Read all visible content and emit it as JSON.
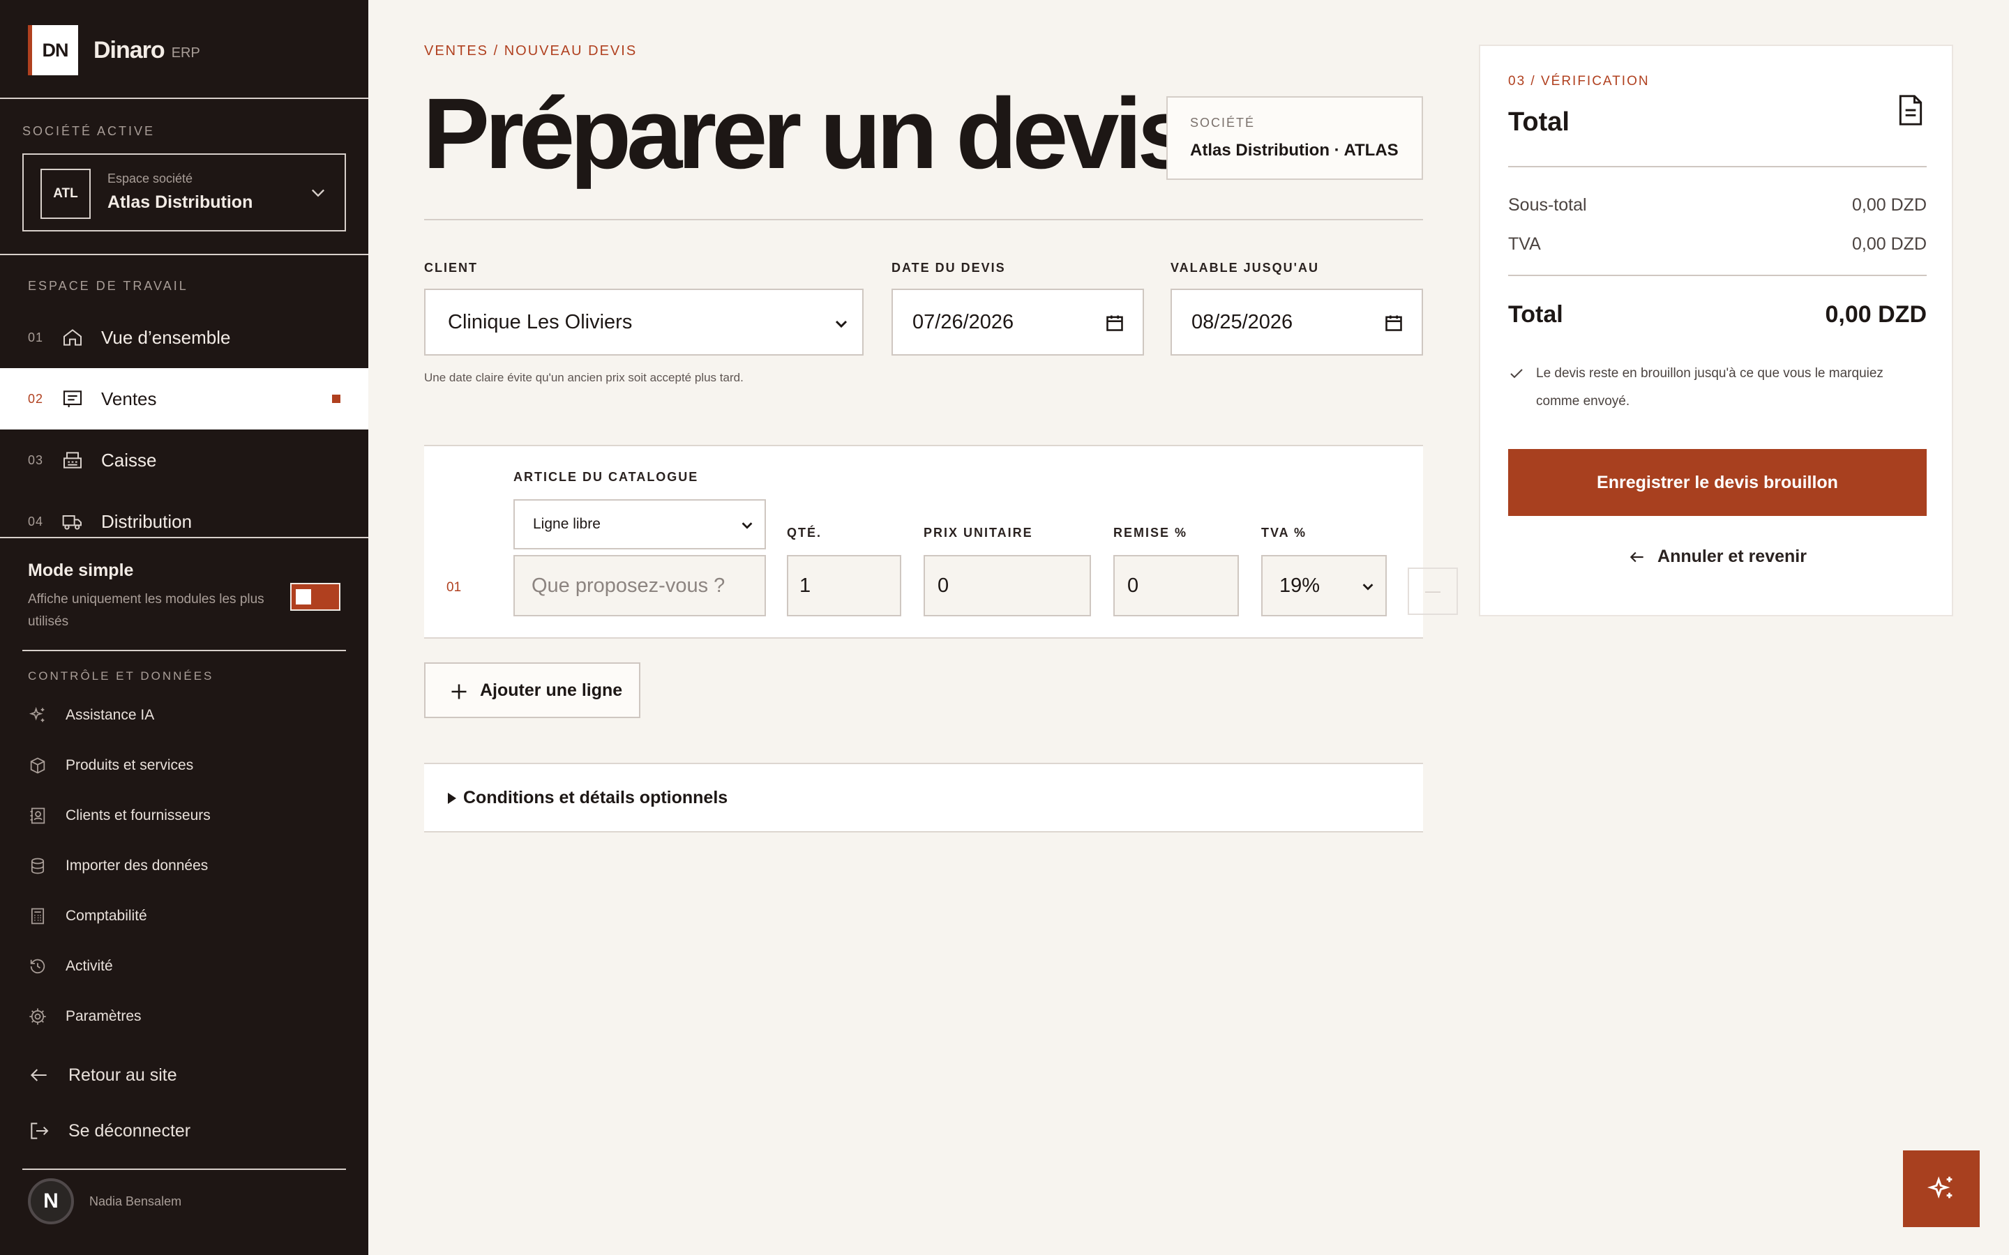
{
  "brand": {
    "logo": "DN",
    "name": "Dinaro",
    "sub": "ERP"
  },
  "sidebar": {
    "active_company_title": "SOCIÉTÉ ACTIVE",
    "company": {
      "badge": "ATL",
      "label": "Espace société",
      "name": "Atlas Distribution"
    },
    "workspace_title": "ESPACE DE TRAVAIL",
    "nav": [
      {
        "num": "01",
        "label": "Vue d’ensemble",
        "icon": "home-icon"
      },
      {
        "num": "02",
        "label": "Ventes",
        "icon": "receipt-icon",
        "active": true
      },
      {
        "num": "03",
        "label": "Caisse",
        "icon": "register-icon"
      },
      {
        "num": "04",
        "label": "Distribution",
        "icon": "truck-icon"
      }
    ],
    "mode": {
      "title": "Mode simple",
      "desc": "Affiche uniquement les modules les plus utilisés",
      "enabled": true
    },
    "control_title": "CONTRÔLE ET DONNÉES",
    "control_items": [
      {
        "label": "Assistance IA",
        "icon": "sparkles-icon"
      },
      {
        "label": "Produits et services",
        "icon": "box-icon"
      },
      {
        "label": "Clients et fournisseurs",
        "icon": "contacts-icon"
      },
      {
        "label": "Importer des données",
        "icon": "database-icon"
      },
      {
        "label": "Comptabilité",
        "icon": "calculator-icon"
      },
      {
        "label": "Activité",
        "icon": "history-icon"
      },
      {
        "label": "Paramètres",
        "icon": "gear-icon"
      }
    ],
    "back_label": "Retour au site",
    "logout_label": "Se déconnecter",
    "user": {
      "initial": "N",
      "name": "Nadia Bensalem"
    }
  },
  "main": {
    "breadcrumb": "VENTES / NOUVEAU DEVIS",
    "title": "Préparer un devis",
    "company_card": {
      "label": "SOCIÉTÉ",
      "value": "Atlas Distribution · ATLAS"
    },
    "client": {
      "label": "CLIENT",
      "value": "Clinique Les Oliviers"
    },
    "quote_date": {
      "label": "DATE DU DEVIS",
      "value": "07/26/2026"
    },
    "valid_until": {
      "label": "VALABLE JUSQU'AU",
      "value": "08/25/2026"
    },
    "hint": "Une date claire évite qu'un ancien prix soit accepté plus tard.",
    "line": {
      "num": "01",
      "catalog_label": "ARTICLE DU CATALOGUE",
      "catalog_value": "Ligne libre",
      "description_placeholder": "Que proposez-vous ?",
      "qty_label": "QTÉ.",
      "qty": "1",
      "price_label": "PRIX UNITAIRE",
      "price": "0",
      "discount_label": "REMISE %",
      "discount": "0",
      "vat_label": "TVA %",
      "vat": "19%",
      "remove": "—"
    },
    "add_line_label": "Ajouter une ligne",
    "details_label": "Conditions et détails optionnels"
  },
  "summary": {
    "step": "03 / VÉRIFICATION",
    "title": "Total",
    "subtotal_label": "Sous-total",
    "subtotal": "0,00 DZD",
    "vat_label": "TVA",
    "vat": "0,00 DZD",
    "total_label": "Total",
    "total": "0,00 DZD",
    "note": "Le devis reste en brouillon jusqu'à ce que vous le marquiez comme envoyé.",
    "save_label": "Enregistrer le devis brouillon",
    "cancel_label": "Annuler et revenir"
  },
  "colors": {
    "accent": "#b0401f",
    "sidebar_bg": "#1e1614",
    "page_bg": "#f7f4ef"
  }
}
